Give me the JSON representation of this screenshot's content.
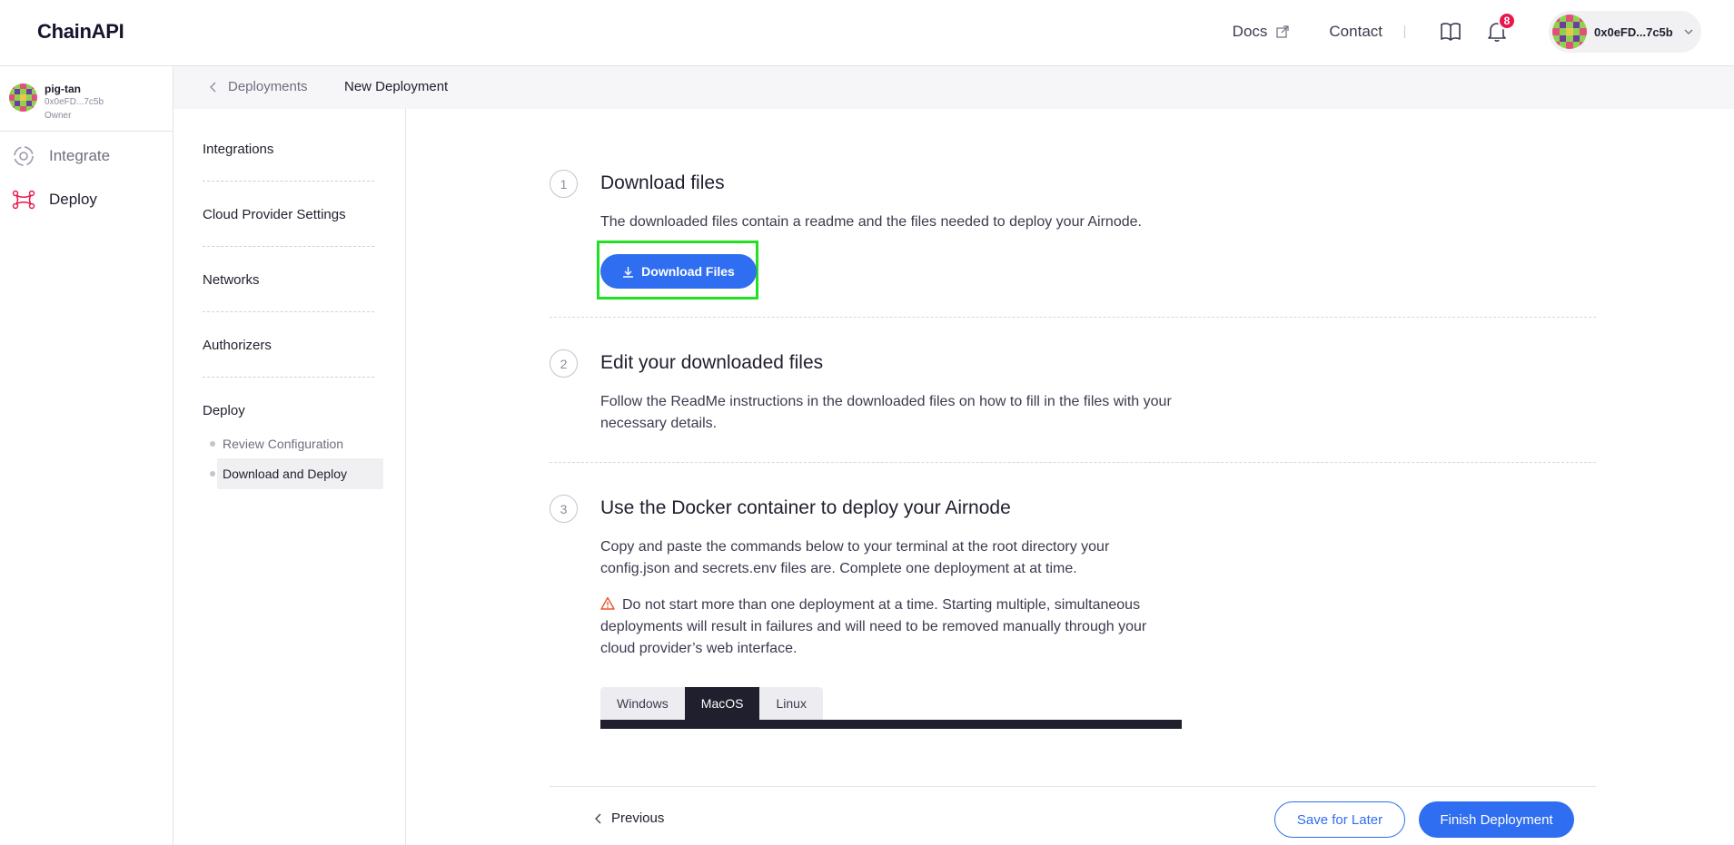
{
  "header": {
    "logo": "ChainAPI",
    "docs_label": "Docs",
    "contact_label": "Contact",
    "notification_count": "8",
    "account_address": "0x0eFD...7c5b",
    "icons": {
      "docs": "external-link-icon",
      "book": "book-icon",
      "bell": "bell-icon",
      "account": "chevron-down-icon"
    }
  },
  "sidebar": {
    "user": {
      "name": "pig-tan",
      "address": "0x0eFD...7c5b",
      "role": "Owner"
    },
    "items": [
      {
        "label": "Integrate",
        "icon": "integrate-icon"
      },
      {
        "label": "Deploy",
        "icon": "deploy-icon"
      }
    ]
  },
  "breadcrumb": {
    "back_label": "Deployments",
    "current": "New Deployment"
  },
  "steps": {
    "items": [
      "Integrations",
      "Cloud Provider Settings",
      "Networks",
      "Authorizers",
      "Deploy"
    ],
    "substeps": [
      "Review Configuration",
      "Download and Deploy"
    ],
    "active_substep": "Download and Deploy"
  },
  "main": {
    "sections": [
      {
        "number": "1",
        "title": "Download files",
        "text": "The downloaded files contain a readme and the files needed to deploy your Airnode.",
        "button": "Download Files"
      },
      {
        "number": "2",
        "title": "Edit your downloaded files",
        "text": "Follow the ReadMe instructions in the downloaded files on how to fill in the files with your necessary details."
      },
      {
        "number": "3",
        "title": "Use the Docker container to deploy your Airnode",
        "text": "Copy and paste the commands below to your terminal at the root directory your config.json and secrets.env files are. Complete one deployment at at time.",
        "warning": "Do not start more than one deployment at a time. Starting multiple, simultaneous deployments will result in failures and will need to be removed manually through your cloud provider’s web interface.",
        "tabs": [
          "Windows",
          "MacOS",
          "Linux"
        ],
        "active_tab": "MacOS"
      }
    ]
  },
  "footer": {
    "previous_label": "Previous",
    "save_label": "Save for Later",
    "finish_label": "Finish Deployment"
  },
  "colors": {
    "accent": "#2f6ef0",
    "highlight": "#22e022",
    "badge": "#e8164d",
    "dark": "#1f1f2e"
  }
}
